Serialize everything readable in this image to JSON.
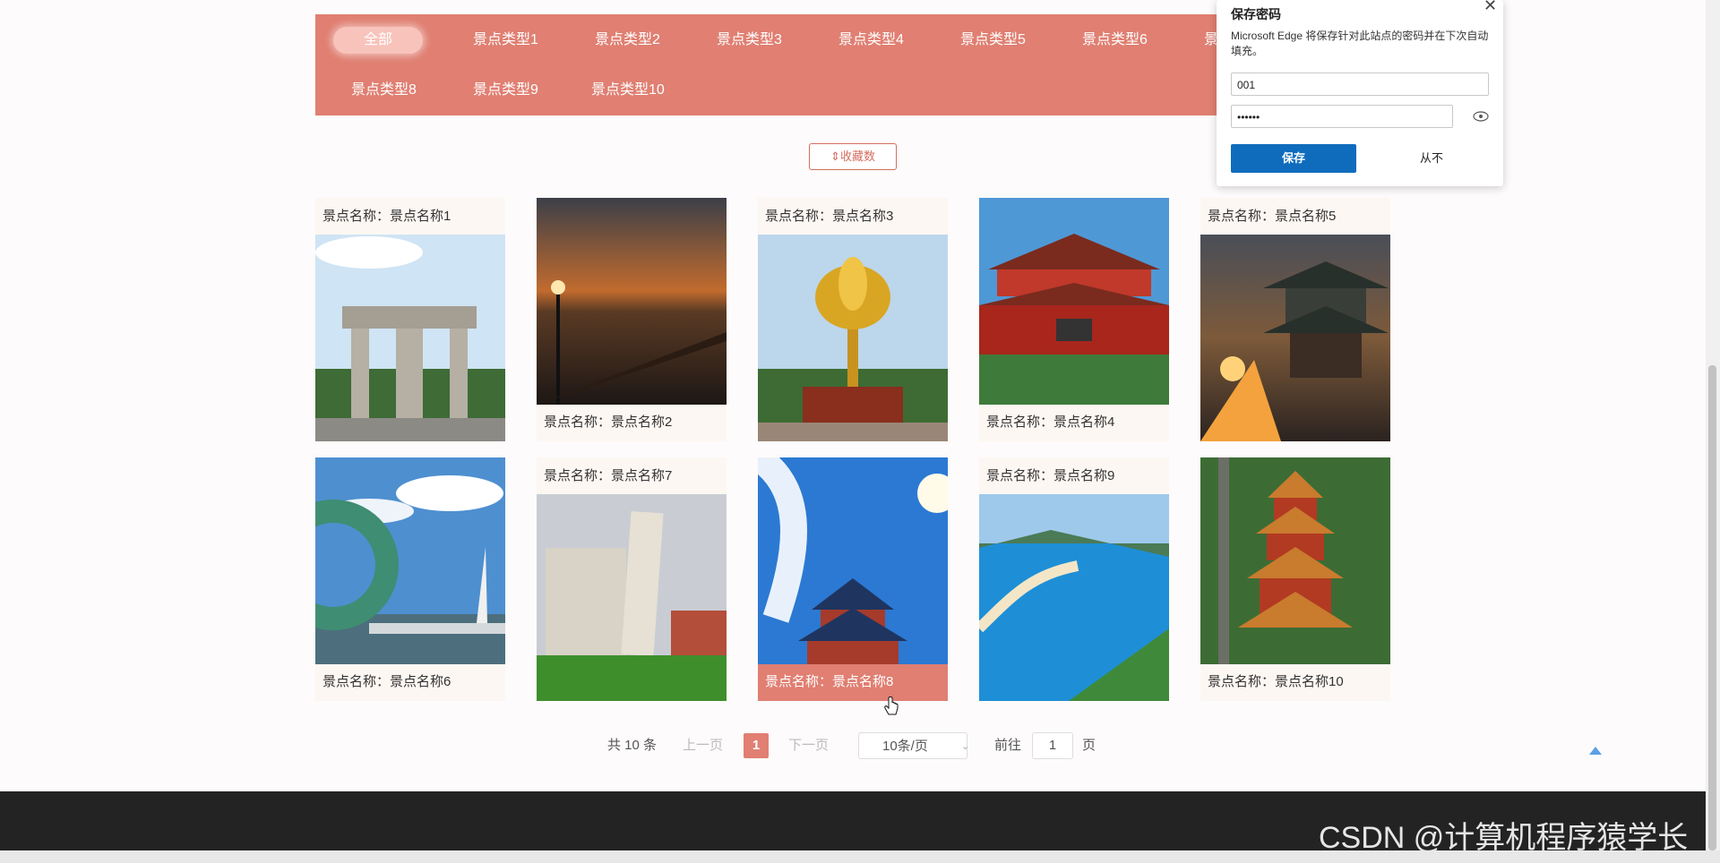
{
  "categories": {
    "items": [
      "全部",
      "景点类型1",
      "景点类型2",
      "景点类型3",
      "景点类型4",
      "景点类型5",
      "景点类型6",
      "景",
      "景点类型8",
      "景点类型9",
      "景点类型10"
    ],
    "active": "全部"
  },
  "sort_button": {
    "label": "收藏数",
    "icon": "sort-updown-icon"
  },
  "name_prefix": "景点名称：",
  "cards": [
    {
      "name": "景点名称：景点名称1"
    },
    {
      "name": "景点名称：景点名称2"
    },
    {
      "name": "景点名称：景点名称3"
    },
    {
      "name": "景点名称：景点名称4"
    },
    {
      "name": "景点名称：景点名称5"
    },
    {
      "name": "景点名称：景点名称6"
    },
    {
      "name": "景点名称：景点名称7"
    },
    {
      "name": "景点名称：景点名称8"
    },
    {
      "name": "景点名称：景点名称9"
    },
    {
      "name": "景点名称：景点名称10"
    }
  ],
  "pagination": {
    "total": "共 10 条",
    "prev": "上一页",
    "current": "1",
    "next": "下一页",
    "page_size": "10条/页",
    "goto_label": "前往",
    "goto_value": "1",
    "page_suffix": "页"
  },
  "save_password_dialog": {
    "title": "保存密码",
    "description": "Microsoft Edge 将保存针对此站点的密码并在下次自动填充。",
    "username": "001",
    "password": "••••••",
    "save_label": "保存",
    "never_label": "从不"
  },
  "watermark": "CSDN @计算机程序猿学长",
  "colors": {
    "accent": "#e07f72",
    "edge_blue": "#0f6cbd",
    "footer": "#232323"
  }
}
